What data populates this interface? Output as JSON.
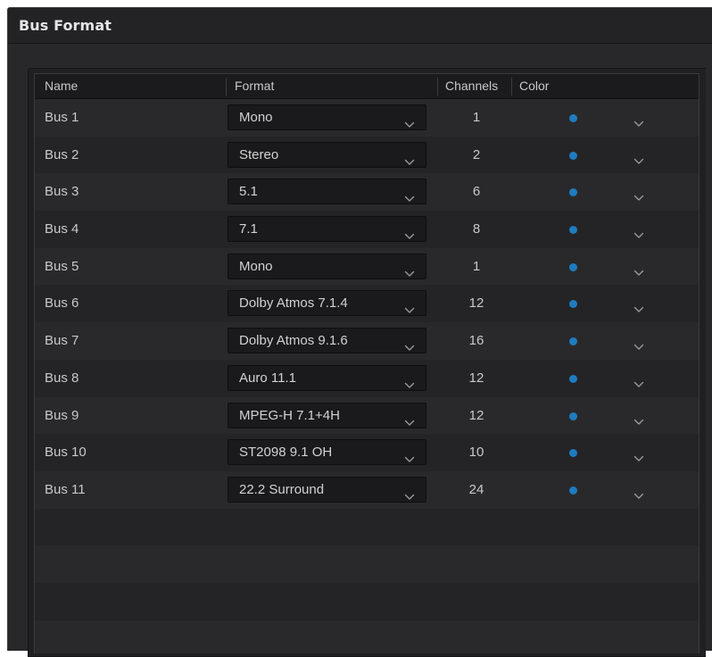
{
  "dialog": {
    "title": "Bus Format"
  },
  "table": {
    "headers": {
      "name": "Name",
      "format": "Format",
      "channels": "Channels",
      "color": "Color"
    },
    "rows": [
      {
        "name": "Bus 1",
        "format": "Mono",
        "channels": "1"
      },
      {
        "name": "Bus 2",
        "format": "Stereo",
        "channels": "2"
      },
      {
        "name": "Bus 3",
        "format": "5.1",
        "channels": "6"
      },
      {
        "name": "Bus 4",
        "format": "7.1",
        "channels": "8"
      },
      {
        "name": "Bus 5",
        "format": "Mono",
        "channels": "1"
      },
      {
        "name": "Bus 6",
        "format": "Dolby Atmos 7.1.4",
        "channels": "12"
      },
      {
        "name": "Bus 7",
        "format": "Dolby Atmos 9.1.6",
        "channels": "16"
      },
      {
        "name": "Bus 8",
        "format": "Auro 11.1",
        "channels": "12"
      },
      {
        "name": "Bus 9",
        "format": "MPEG-H 7.1+4H",
        "channels": "12"
      },
      {
        "name": "Bus 10",
        "format": "ST2098 9.1 OH",
        "channels": "10"
      },
      {
        "name": "Bus 11",
        "format": "22.2 Surround",
        "channels": "24"
      }
    ]
  },
  "colors": {
    "bus_color": "#1f7cc0",
    "background": "#28282b",
    "row_odd": "#29292c",
    "row_even": "#242427"
  },
  "icons": {
    "format_dropdown": "chevron-down-icon",
    "color_dropdown": "chevron-down-icon",
    "color_swatch": "color-dot-icon"
  }
}
